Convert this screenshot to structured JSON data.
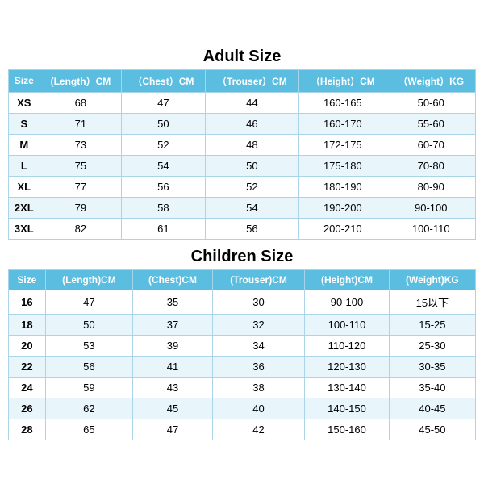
{
  "adult": {
    "title": "Adult Size",
    "headers": [
      "Size",
      "(Length）CM",
      "（Chest）CM",
      "（Trouser）CM",
      "（Height）CM",
      "（Weight）KG"
    ],
    "rows": [
      [
        "XS",
        "68",
        "47",
        "44",
        "160-165",
        "50-60"
      ],
      [
        "S",
        "71",
        "50",
        "46",
        "160-170",
        "55-60"
      ],
      [
        "M",
        "73",
        "52",
        "48",
        "172-175",
        "60-70"
      ],
      [
        "L",
        "75",
        "54",
        "50",
        "175-180",
        "70-80"
      ],
      [
        "XL",
        "77",
        "56",
        "52",
        "180-190",
        "80-90"
      ],
      [
        "2XL",
        "79",
        "58",
        "54",
        "190-200",
        "90-100"
      ],
      [
        "3XL",
        "82",
        "61",
        "56",
        "200-210",
        "100-110"
      ]
    ]
  },
  "children": {
    "title": "Children Size",
    "headers": [
      "Size",
      "(Length)CM",
      "(Chest)CM",
      "(Trouser)CM",
      "(Height)CM",
      "(Weight)KG"
    ],
    "rows": [
      [
        "16",
        "47",
        "35",
        "30",
        "90-100",
        "15以下"
      ],
      [
        "18",
        "50",
        "37",
        "32",
        "100-110",
        "15-25"
      ],
      [
        "20",
        "53",
        "39",
        "34",
        "110-120",
        "25-30"
      ],
      [
        "22",
        "56",
        "41",
        "36",
        "120-130",
        "30-35"
      ],
      [
        "24",
        "59",
        "43",
        "38",
        "130-140",
        "35-40"
      ],
      [
        "26",
        "62",
        "45",
        "40",
        "140-150",
        "40-45"
      ],
      [
        "28",
        "65",
        "47",
        "42",
        "150-160",
        "45-50"
      ]
    ]
  }
}
